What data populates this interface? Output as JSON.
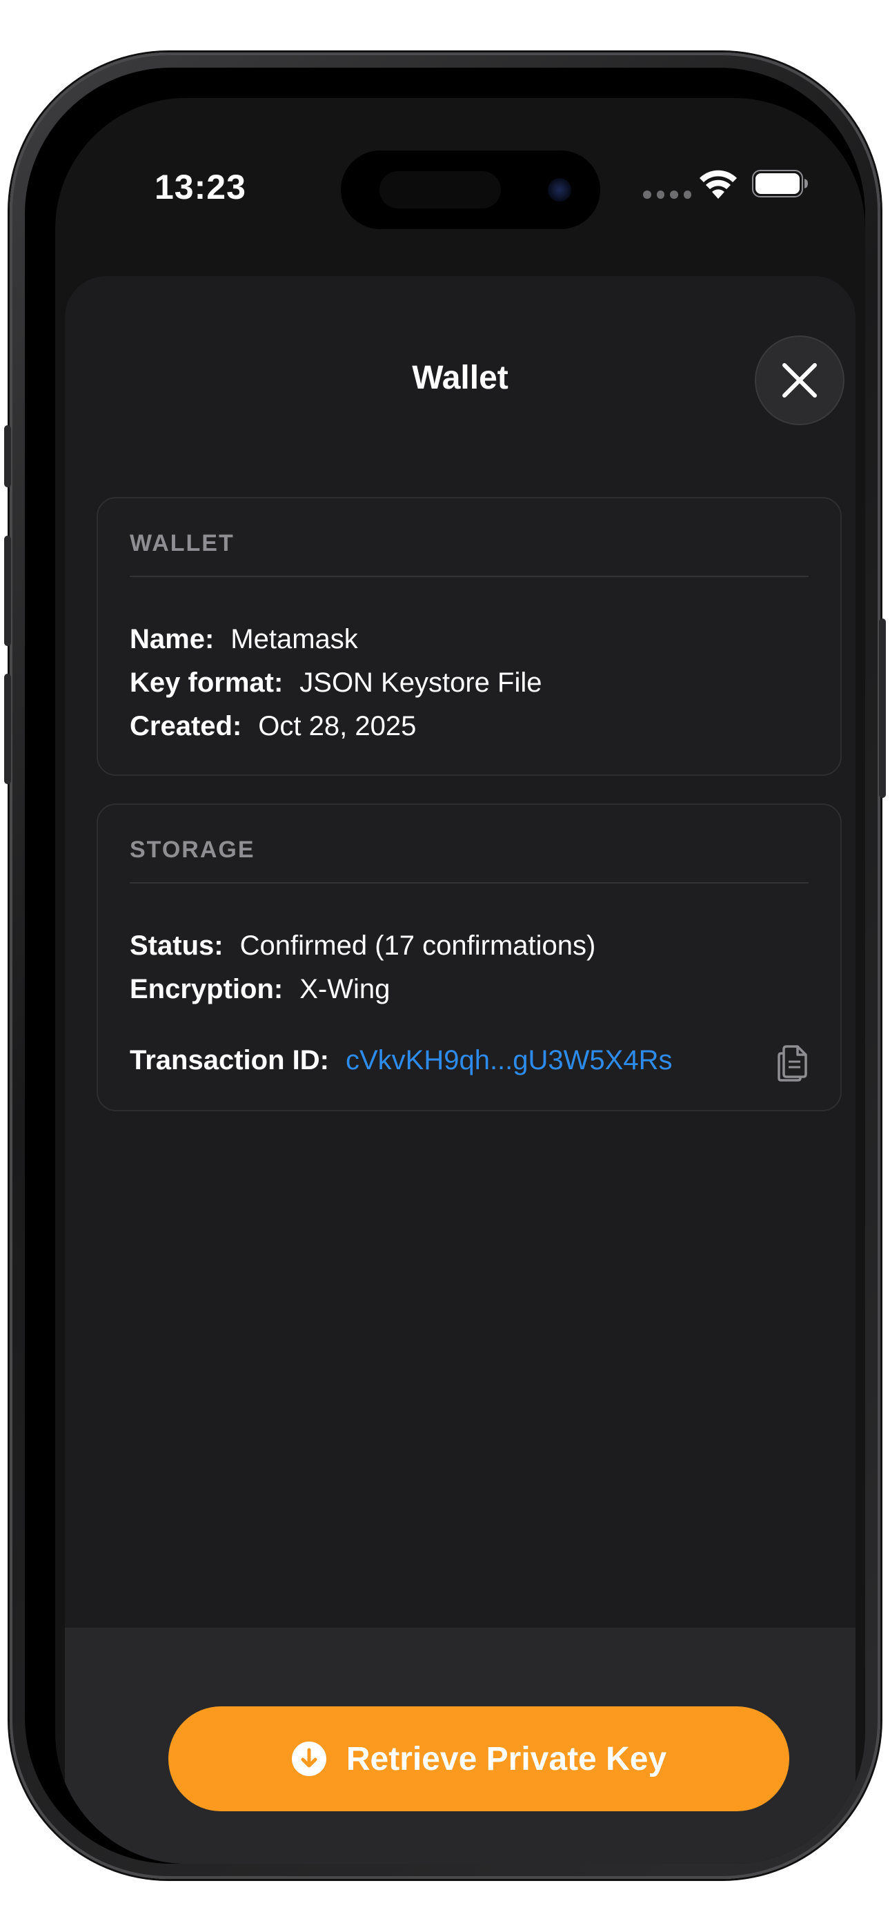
{
  "status_bar": {
    "time": "13:23",
    "icons": [
      "cellular-dots-icon",
      "wifi-icon",
      "battery-icon"
    ]
  },
  "sheet": {
    "title": "Wallet",
    "close_icon": "close-x-icon"
  },
  "wallet_card": {
    "header": "WALLET",
    "fields": [
      {
        "label": "Name:",
        "value": "Metamask"
      },
      {
        "label": "Key format:",
        "value": "JSON Keystore File"
      },
      {
        "label": "Created:",
        "value": "Oct 28, 2025"
      }
    ]
  },
  "storage_card": {
    "header": "STORAGE",
    "fields": [
      {
        "label": "Status:",
        "value": "Confirmed (17 confirmations)"
      },
      {
        "label": "Encryption:",
        "value": "X-Wing"
      }
    ],
    "transaction": {
      "label": "Transaction ID:",
      "value": "cVkvKH9qh...gU3W5X4Rs",
      "copy_icon": "copy-icon"
    }
  },
  "action": {
    "label": "Retrieve Private Key",
    "icon": "download-circle-icon"
  },
  "colors": {
    "accent": "#fb9a1e",
    "link": "#2d8ceb",
    "sheet_bg": "#1c1c1e",
    "card_bg": "#1e1e20",
    "muted": "#8e8e93"
  }
}
